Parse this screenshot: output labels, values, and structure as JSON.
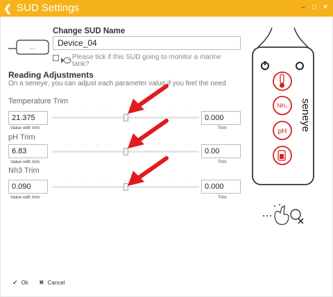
{
  "window": {
    "title": "SUD Settings",
    "colors": {
      "title_bar": "#f6b21b",
      "arrow": "#e01c1c",
      "device_red": "#d42020"
    }
  },
  "name_section": {
    "heading": "Change SUD Name",
    "value": "Device_04",
    "device_icon_text": "....",
    "marine_checkbox_checked": false,
    "marine_text": "Please tick if this SUD going to monitor a marine tank?"
  },
  "adjustments": {
    "heading": "Reading Adjustments",
    "description": "On a seneye, you can adjust each parameter value if you feel the need",
    "params": [
      {
        "label": "Temperature Trim",
        "value": "21.375",
        "value_caption": "Value with trim",
        "trim": "0.000",
        "trim_caption": "Trim",
        "slider_position": 0.5
      },
      {
        "label": "pH Trim",
        "value": "6.83",
        "value_caption": "Value with trim",
        "trim": "0.00",
        "trim_caption": "Trim",
        "slider_position": 0.5
      },
      {
        "label": "Nh3 Trim",
        "value": "0.090",
        "value_caption": "Value with trim",
        "trim": "0.000",
        "trim_caption": "Trim",
        "slider_position": 0.5
      }
    ]
  },
  "device": {
    "brand": "seneye",
    "icons": [
      "thermometer-icon",
      "nh3-icon",
      "ph-icon",
      "battery-icon"
    ],
    "nh3_text": "NH₃",
    "ph_text": "pH"
  },
  "footer": {
    "ok_label": "Ok",
    "cancel_label": "Cancel"
  }
}
